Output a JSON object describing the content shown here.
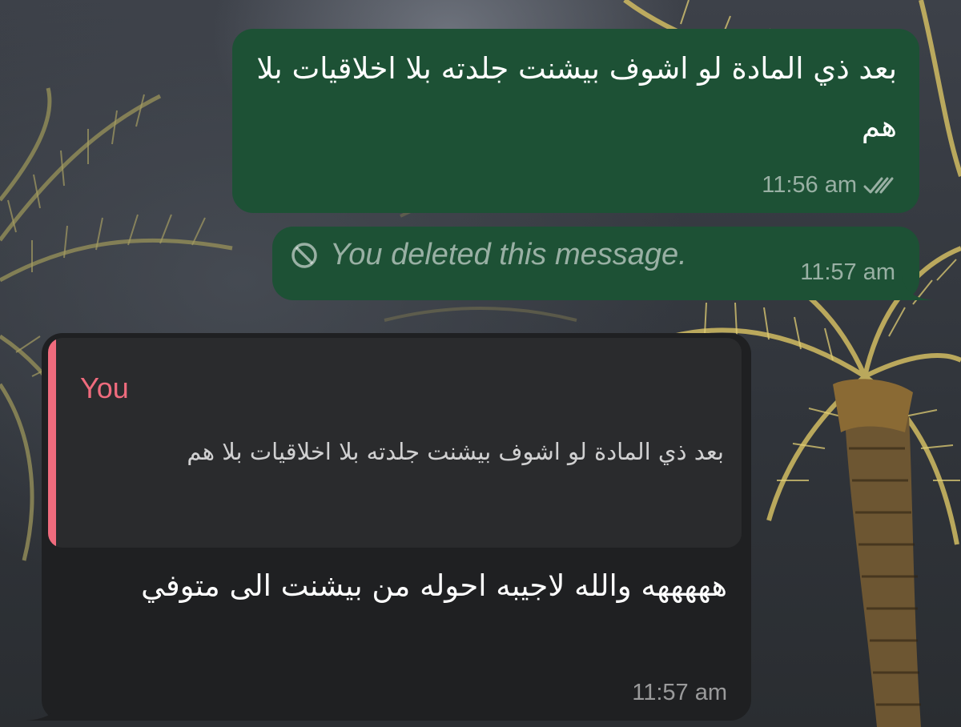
{
  "messages": [
    {
      "direction": "outgoing",
      "text": "بعد ذي المادة لو اشوف بيشنت جلدته بلا اخلاقيات بلا هم",
      "time": "11:56 am",
      "status": "read-double-check-icon"
    },
    {
      "direction": "outgoing",
      "deleted": true,
      "text": "You deleted this message.",
      "time": "11:57 am",
      "icon": "prohibited-icon"
    },
    {
      "direction": "incoming",
      "reply": {
        "author": "You",
        "text": "بعد ذي المادة لو اشوف بيشنت جلدته بلا اخلاقيات بلا هم"
      },
      "text": "هههههه والله لاجيبه احوله من بيشنت الى متوفي",
      "time": "11:57 am"
    }
  ],
  "colors": {
    "outgoing_bubble": "#1d5135",
    "incoming_bubble": "#1f2022",
    "quote_accent": "#ef6b7d"
  }
}
